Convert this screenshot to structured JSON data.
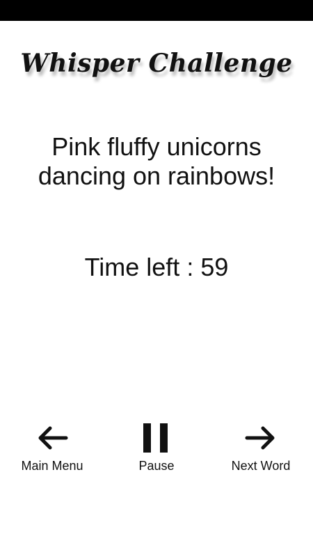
{
  "title": "Whisper Challenge",
  "phrase": {
    "line1": "Pink fluffy unicorns",
    "line2": "dancing on rainbows!"
  },
  "timer": {
    "label": "Time left : 59"
  },
  "controls": {
    "main_menu": {
      "label": "Main Menu",
      "icon": "arrow-left-icon"
    },
    "pause": {
      "label": "Pause",
      "icon": "pause-icon"
    },
    "next_word": {
      "label": "Next Word",
      "icon": "arrow-right-icon"
    }
  },
  "colors": {
    "background": "#ffffff",
    "text": "#111111",
    "status_bar": "#000000"
  }
}
